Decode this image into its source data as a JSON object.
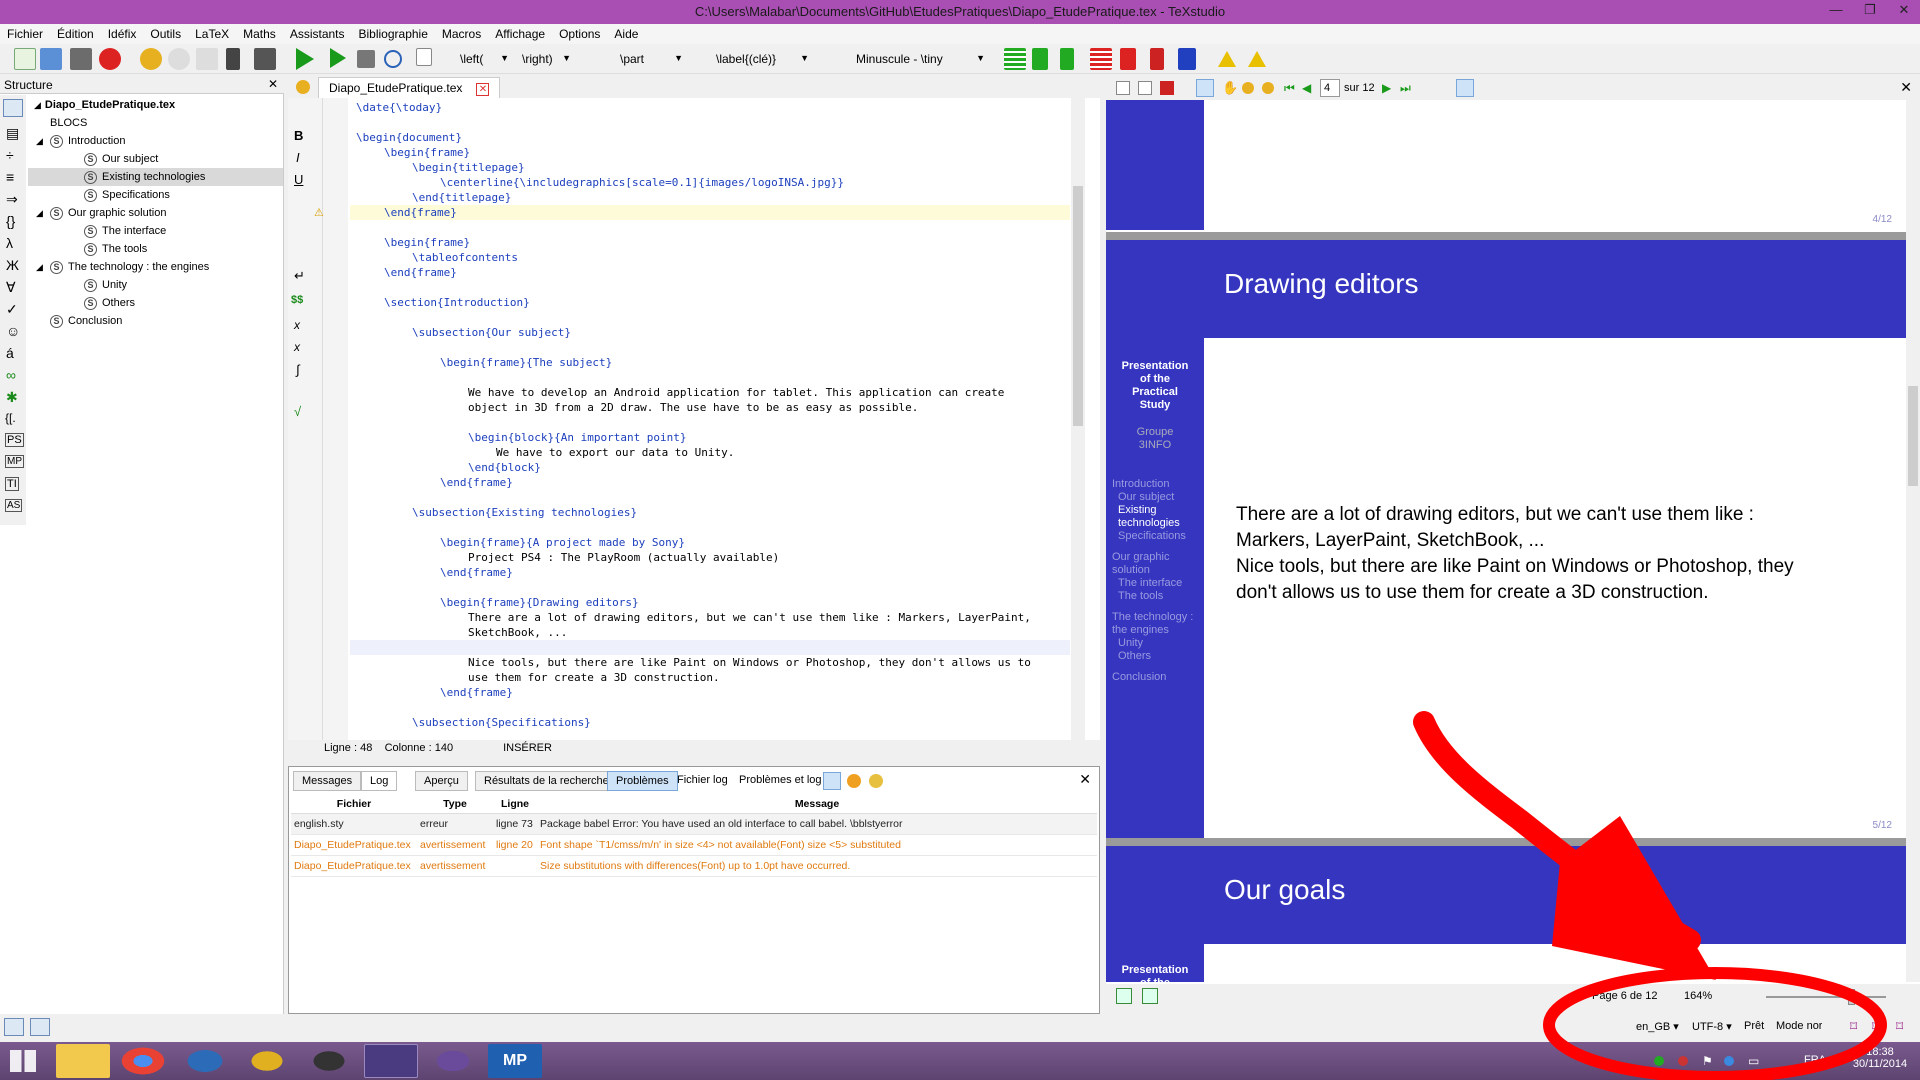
{
  "window": {
    "title": "C:\\Users\\Malabar\\Documents\\GitHub\\EtudesPratiques\\Diapo_EtudePratique.tex - TeXstudio",
    "controls": [
      "—",
      "❐",
      "✕"
    ]
  },
  "menu": [
    "Fichier",
    "Édition",
    "Idéfix",
    "Outils",
    "LaTeX",
    "Maths",
    "Assistants",
    "Bibliographie",
    "Macros",
    "Affichage",
    "Options",
    "Aide"
  ],
  "toolbar": {
    "combo_left": "\\left(",
    "combo_right": "\\right)",
    "combo_part": "\\part",
    "combo_label": "\\label{(clé)}",
    "combo_size": "Minuscule - \\tiny"
  },
  "structure": {
    "header": "Structure",
    "root": "Diapo_EtudePratique.tex",
    "items": [
      {
        "label": "BLOCS",
        "level": 1,
        "icon": false,
        "expand": ""
      },
      {
        "label": "Introduction",
        "level": 1,
        "icon": true,
        "expand": "◢"
      },
      {
        "label": "Our subject",
        "level": 2,
        "icon": true,
        "expand": ""
      },
      {
        "label": "Existing technologies",
        "level": 2,
        "icon": true,
        "expand": "",
        "selected": true
      },
      {
        "label": "Specifications",
        "level": 2,
        "icon": true,
        "expand": ""
      },
      {
        "label": "Our graphic solution",
        "level": 1,
        "icon": true,
        "expand": "◢"
      },
      {
        "label": "The interface",
        "level": 2,
        "icon": true,
        "expand": ""
      },
      {
        "label": "The tools",
        "level": 2,
        "icon": true,
        "expand": ""
      },
      {
        "label": "The technology : the engines",
        "level": 1,
        "icon": true,
        "expand": "◢"
      },
      {
        "label": "Unity",
        "level": 2,
        "icon": true,
        "expand": ""
      },
      {
        "label": "Others",
        "level": 2,
        "icon": true,
        "expand": ""
      },
      {
        "label": "Conclusion",
        "level": 1,
        "icon": true,
        "expand": ""
      }
    ]
  },
  "left_symbols": [
    "B",
    "I",
    "U",
    "↵",
    "$$",
    "x",
    "x",
    "∫",
    "√"
  ],
  "editor": {
    "tab_label": "Diapo_EtudePratique.tex",
    "lines": [
      {
        "indent": 0,
        "text": "\\date{\\today}"
      },
      {
        "indent": 0,
        "text": ""
      },
      {
        "indent": 0,
        "text": "\\begin{document}"
      },
      {
        "indent": 1,
        "text": "\\begin{frame}"
      },
      {
        "indent": 2,
        "text": "\\begin{titlepage}"
      },
      {
        "indent": 3,
        "text": "\\centerline{\\includegraphics[scale=0.1]{images/logoINSA.jpg}}"
      },
      {
        "indent": 2,
        "text": "\\end{titlepage}"
      },
      {
        "indent": 1,
        "text": "\\end{frame}"
      },
      {
        "indent": 0,
        "text": ""
      },
      {
        "indent": 1,
        "text": "\\begin{frame}"
      },
      {
        "indent": 2,
        "text": "\\tableofcontents"
      },
      {
        "indent": 1,
        "text": "\\end{frame}"
      },
      {
        "indent": 0,
        "text": ""
      },
      {
        "indent": 1,
        "text": "\\section{Introduction}"
      },
      {
        "indent": 0,
        "text": ""
      },
      {
        "indent": 2,
        "text": "\\subsection{Our subject}"
      },
      {
        "indent": 0,
        "text": ""
      },
      {
        "indent": 3,
        "text": "\\begin{frame}{The subject}"
      },
      {
        "indent": 0,
        "text": ""
      },
      {
        "indent": 4,
        "text": "We have to develop an Android application for tablet. This application can create"
      },
      {
        "indent": 4,
        "text": "object in 3D from a 2D draw. The use have to be as easy as possible."
      },
      {
        "indent": 0,
        "text": ""
      },
      {
        "indent": 4,
        "text": "\\begin{block}{An important point}"
      },
      {
        "indent": 5,
        "text": "We have to export our data to Unity."
      },
      {
        "indent": 4,
        "text": "\\end{block}"
      },
      {
        "indent": 3,
        "text": "\\end{frame}"
      },
      {
        "indent": 0,
        "text": ""
      },
      {
        "indent": 2,
        "text": "\\subsection{Existing technologies}"
      },
      {
        "indent": 0,
        "text": ""
      },
      {
        "indent": 3,
        "text": "\\begin{frame}{A project made by Sony}"
      },
      {
        "indent": 4,
        "text": "Project PS4 : The PlayRoom (actually available)"
      },
      {
        "indent": 3,
        "text": "\\end{frame}"
      },
      {
        "indent": 0,
        "text": ""
      },
      {
        "indent": 3,
        "text": "\\begin{frame}{Drawing editors}"
      },
      {
        "indent": 4,
        "text": "There are a lot of drawing editors, but we can't use them like : Markers, LayerPaint,"
      },
      {
        "indent": 4,
        "text": "SketchBook, ..."
      },
      {
        "indent": 0,
        "text": ""
      },
      {
        "indent": 4,
        "text": "Nice tools, but there are like Paint on Windows or Photoshop, they don't allows us to"
      },
      {
        "indent": 4,
        "text": "use them for create a 3D construction."
      },
      {
        "indent": 3,
        "text": "\\end{frame}"
      },
      {
        "indent": 0,
        "text": ""
      },
      {
        "indent": 2,
        "text": "\\subsection{Specifications}"
      }
    ],
    "status_line": "Ligne : 48",
    "status_col": "Colonne : 140",
    "status_mode": "INSÉRER"
  },
  "messages": {
    "tabs": [
      "Messages",
      "Log",
      "Aperçu",
      "Résultats de la recherche",
      "Problèmes",
      "Fichier log",
      "Problèmes et log"
    ],
    "columns": [
      "Fichier",
      "Type",
      "Ligne",
      "Message"
    ],
    "rows": [
      {
        "file": "english.sty",
        "type": "erreur",
        "line": "ligne 73",
        "message": "Package babel Error: You have used an old interface to call babel. \\bblstyerror",
        "kind": "error"
      },
      {
        "file": "Diapo_EtudePratique.tex",
        "type": "avertissement",
        "line": "ligne 20",
        "message": "Font shape `T1/cmss/m/n' in size <4> not available(Font) size <5> substituted",
        "kind": "warning"
      },
      {
        "file": "Diapo_EtudePratique.tex",
        "type": "avertissement",
        "line": "",
        "message": "Size substitutions with differences(Font) up to 1.0pt have occurred.",
        "kind": "warning"
      }
    ]
  },
  "preview": {
    "page_input": "4",
    "page_total": "sur 12",
    "slide1_pageno": "4/12",
    "slide2_title": "Drawing editors",
    "slide2_sidebar_title": "Presentation of the Practical Study",
    "slide2_sidebar_group": "Groupe 3INFO",
    "slide2_nav": [
      "Introduction",
      "Our subject",
      "Existing technologies",
      "Specifications",
      "Our graphic solution",
      "The interface",
      "The tools",
      "The technology : the engines",
      "Unity",
      "Others",
      "Conclusion"
    ],
    "slide2_body1": "There are a lot of drawing editors, but we can't use them like :",
    "slide2_body2": "Markers, LayerPaint, SketchBook, ...",
    "slide2_body3": "Nice tools, but there are like Paint on Windows or Photoshop, they",
    "slide2_body4": "don't allows us to use them for create a 3D construction.",
    "slide2_pageno": "5/12",
    "slide3_title": "Our goals",
    "slide3_sidebar_title": "Presentation of the",
    "status_page": "Page 6 de 12",
    "status_zoom": "164%"
  },
  "bottom": {
    "lang": "en_GB",
    "encoding": "UTF-8",
    "ready": "Prêt",
    "mode": "Mode normal"
  },
  "taskbar": {
    "lang": "FRA",
    "time": "18:38",
    "date": "30/11/2014"
  },
  "colors": {
    "beamer_blue": "#3535c0",
    "title_bar": "#a94fb3",
    "annotation_red": "#ff0000",
    "warning_orange": "#e07a10"
  }
}
